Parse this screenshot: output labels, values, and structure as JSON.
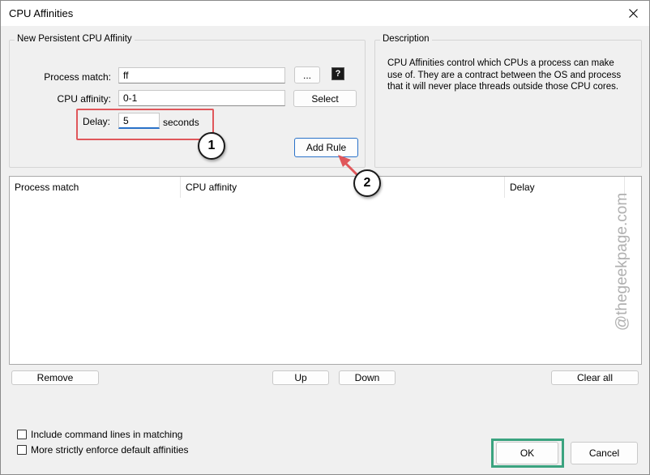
{
  "window": {
    "title": "CPU Affinities"
  },
  "new_rule": {
    "group_title": "New Persistent CPU Affinity",
    "process_match_label": "Process match:",
    "process_match_value": "ff",
    "browse_label": "...",
    "help_label": "?",
    "cpu_affinity_label": "CPU affinity:",
    "cpu_affinity_value": "0-1",
    "select_label": "Select",
    "delay_label": "Delay:",
    "delay_value": "5",
    "delay_unit": "seconds",
    "add_rule_label": "Add Rule"
  },
  "description": {
    "group_title": "Description",
    "text": "CPU Affinities control which CPUs a process can make use of. They are a contract between the OS and process that it will never place threads outside those CPU cores."
  },
  "rules_table": {
    "columns": [
      "Process match",
      "CPU affinity",
      "Delay"
    ]
  },
  "list_buttons": {
    "remove": "Remove",
    "up": "Up",
    "down": "Down",
    "clear_all": "Clear all"
  },
  "options": {
    "include_command_lines": "Include command lines in matching",
    "strict_enforce": "More strictly enforce default affinities"
  },
  "footer": {
    "ok": "OK",
    "cancel": "Cancel"
  },
  "annotations": {
    "step1": "1",
    "step2": "2",
    "watermark": "@thegeekpage.com"
  },
  "colors": {
    "highlight_red": "#e0575b",
    "highlight_green": "#3ba37f",
    "accent_blue": "#2a72c9"
  }
}
